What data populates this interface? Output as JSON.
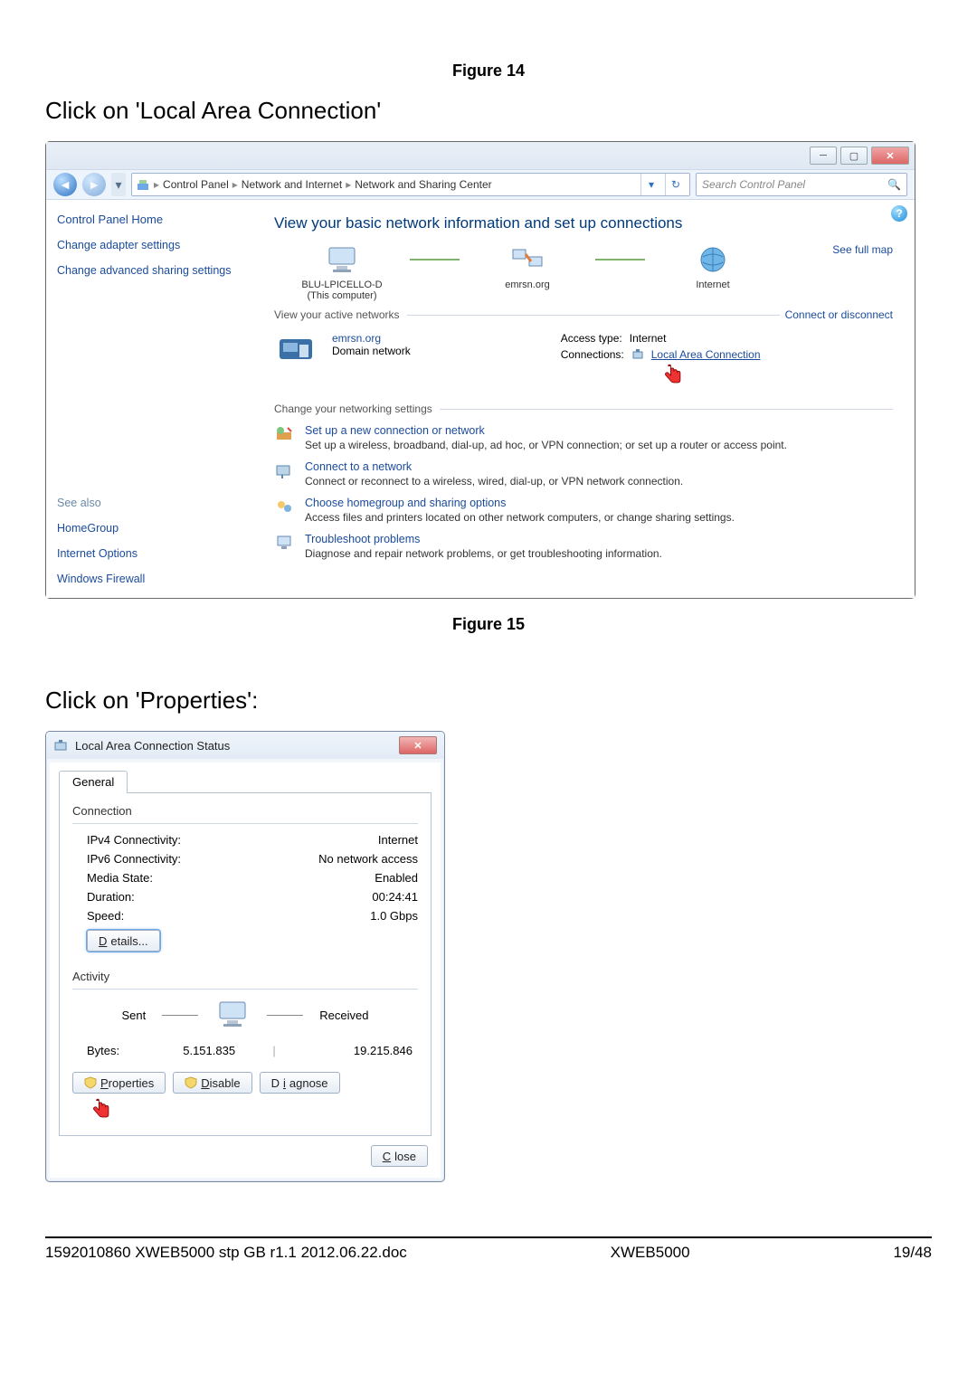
{
  "figure14_label": "Figure 14",
  "instruction1": "Click on 'Local Area Connection'",
  "cp": {
    "breadcrumb": {
      "root": "Control Panel",
      "l2": "Network and Internet",
      "l3": "Network and Sharing Center"
    },
    "search_placeholder": "Search Control Panel",
    "sidebar": {
      "home": "Control Panel Home",
      "adapter": "Change adapter settings",
      "advanced": "Change advanced sharing settings",
      "seealso": "See also",
      "homegroup": "HomeGroup",
      "inetopt": "Internet Options",
      "firewall": "Windows Firewall"
    },
    "heading": "View your basic network information and set up connections",
    "seefullmap": "See full map",
    "nodes": {
      "pc": "BLU-LPICELLO-D",
      "pc_sub": "(This computer)",
      "domain": "emrsn.org",
      "internet": "Internet"
    },
    "group_active": "View your active networks",
    "connect_disconnect": "Connect or disconnect",
    "netname": "emrsn.org",
    "nettype": "Domain network",
    "access_label": "Access type:",
    "access_value": "Internet",
    "conn_label": "Connections:",
    "conn_value": "Local Area Connection",
    "group_change": "Change your networking settings",
    "tasks": [
      {
        "title": "Set up a new connection or network",
        "desc": "Set up a wireless, broadband, dial-up, ad hoc, or VPN connection; or set up a router or access point."
      },
      {
        "title": "Connect to a network",
        "desc": "Connect or reconnect to a wireless, wired, dial-up, or VPN network connection."
      },
      {
        "title": "Choose homegroup and sharing options",
        "desc": "Access files and printers located on other network computers, or change sharing settings."
      },
      {
        "title": "Troubleshoot problems",
        "desc": "Diagnose and repair network problems, or get troubleshooting information."
      }
    ]
  },
  "figure15_label": "Figure 15",
  "instruction2": "Click on 'Properties':",
  "dlg": {
    "title": "Local Area Connection Status",
    "tab": "General",
    "section_connection": "Connection",
    "rows": {
      "ipv4_l": "IPv4 Connectivity:",
      "ipv4_v": "Internet",
      "ipv6_l": "IPv6 Connectivity:",
      "ipv6_v": "No network access",
      "media_l": "Media State:",
      "media_v": "Enabled",
      "dur_l": "Duration:",
      "dur_v": "00:24:41",
      "speed_l": "Speed:",
      "speed_v": "1.0 Gbps"
    },
    "details_btn": "Details...",
    "section_activity": "Activity",
    "sent": "Sent",
    "received": "Received",
    "bytes_label": "Bytes:",
    "bytes_sent": "5.151.835",
    "bytes_recv": "19.215.846",
    "properties_btn": "Properties",
    "disable_btn": "Disable",
    "diagnose_btn": "Diagnose",
    "close_btn": "Close"
  },
  "footer": {
    "left": "1592010860 XWEB5000 stp GB r1.1 2012.06.22.doc",
    "center": "XWEB5000",
    "right": "19/48"
  }
}
